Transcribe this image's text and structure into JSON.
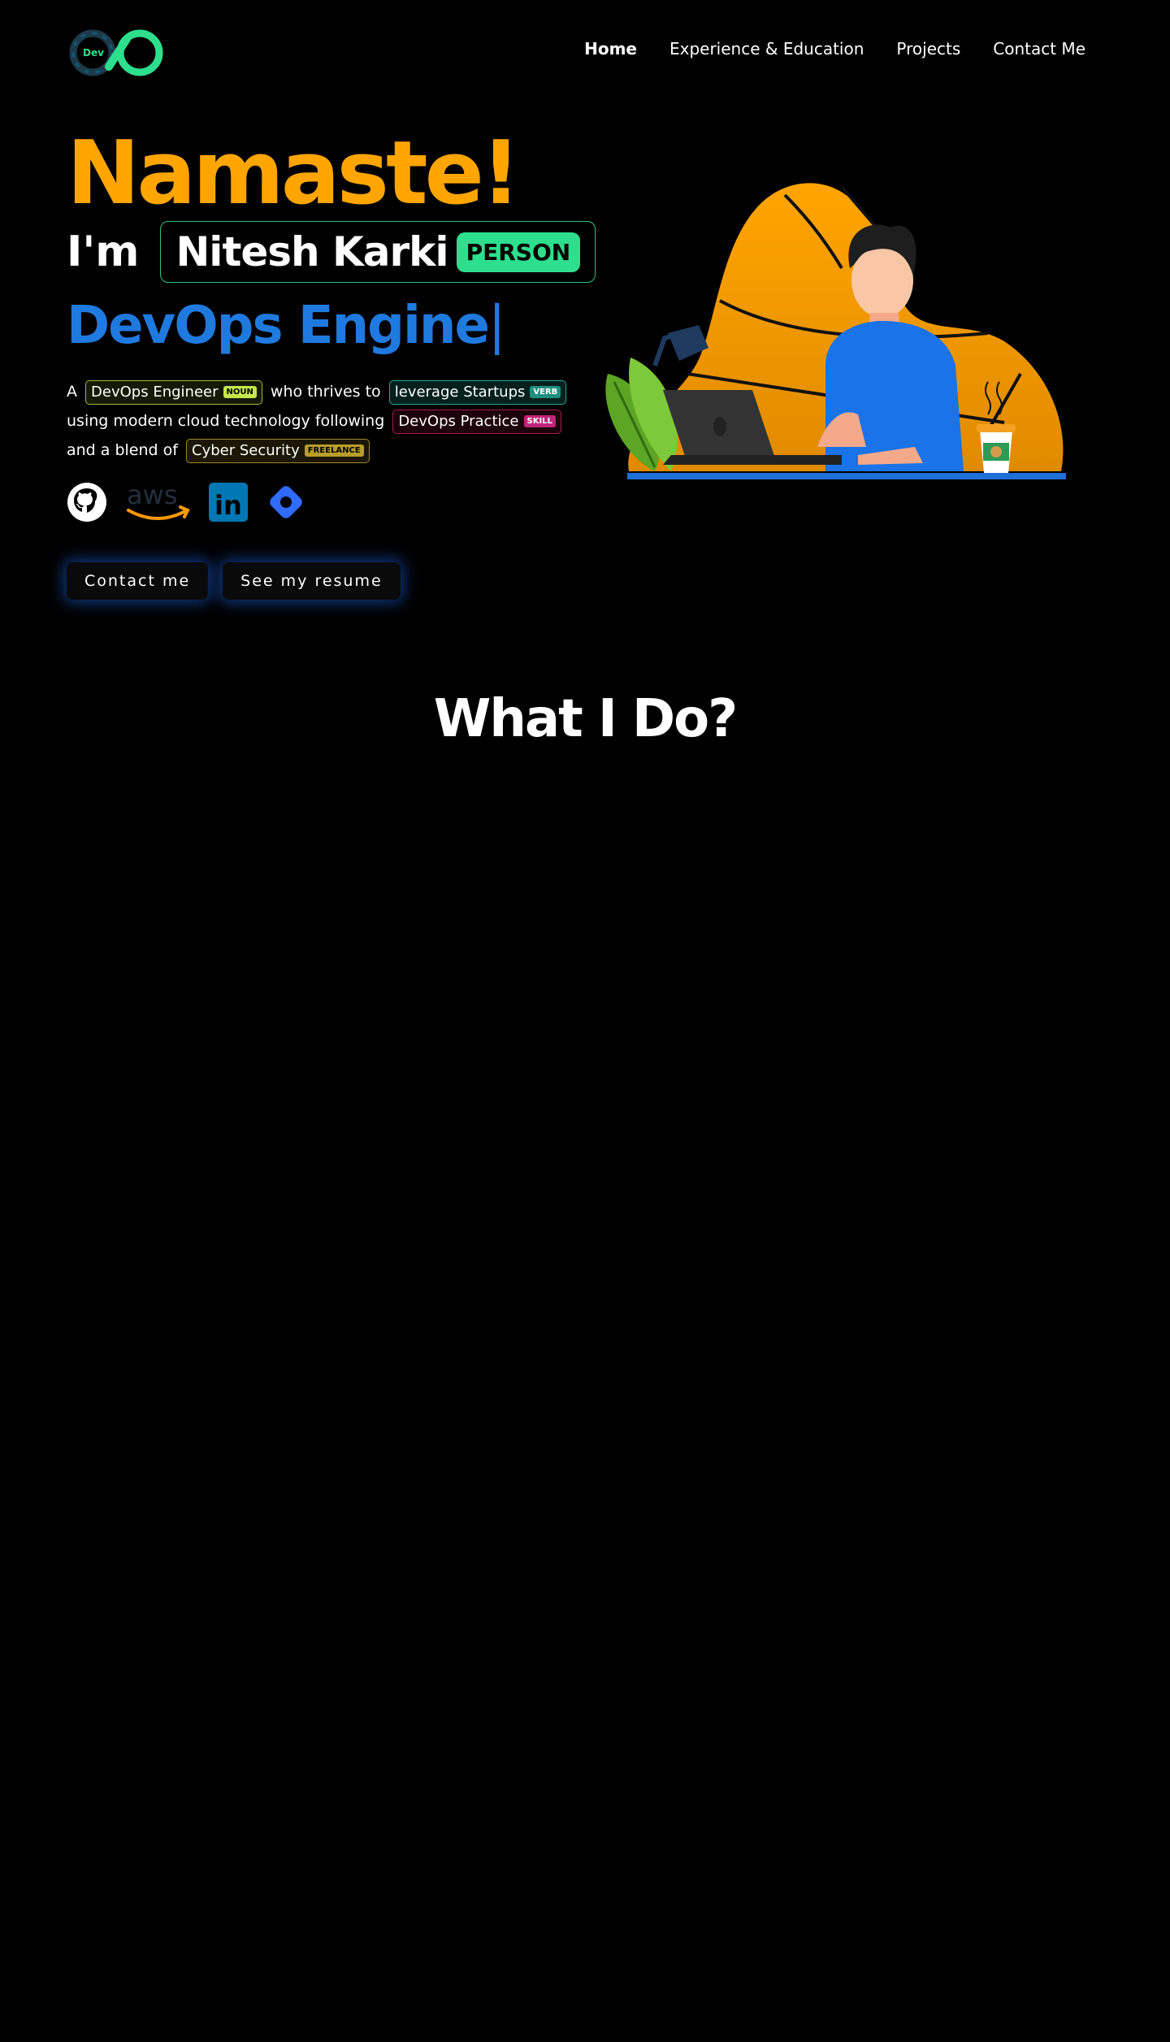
{
  "nav": {
    "logo_text": "Dev",
    "items": [
      {
        "label": "Home",
        "active": true
      },
      {
        "label": "Experience & Education",
        "active": false
      },
      {
        "label": "Projects",
        "active": false
      },
      {
        "label": "Contact Me",
        "active": false
      }
    ]
  },
  "hero": {
    "greeting": "Namaste!",
    "im": "I'm",
    "name": "Nitesh Karki",
    "name_tag": "PERSON",
    "role": "DevOps Engine",
    "role_cursor": "|",
    "description": {
      "t1": "A",
      "chip1": {
        "label": "DevOps Engineer",
        "tag": "NOUN"
      },
      "t2": "who thrives to",
      "chip2": {
        "label": "leverage Startups",
        "tag": "VERB"
      },
      "t3": "using modern cloud technology following",
      "chip3": {
        "label": "DevOps Practice",
        "tag": "SKILL"
      },
      "t4": "and a blend of",
      "chip4": {
        "label": "Cyber Security",
        "tag": "FREELANCE"
      }
    },
    "socials": [
      {
        "icon": "github-icon"
      },
      {
        "icon": "aws-icon",
        "text": "aws"
      },
      {
        "icon": "linkedin-icon",
        "text": "in"
      },
      {
        "icon": "diamond-icon"
      }
    ],
    "buttons": {
      "contact": "Contact me",
      "resume": "See my resume"
    }
  },
  "what_i_do": {
    "title": "What I Do?"
  },
  "colors": {
    "accent_orange": "#FFA500",
    "accent_blue": "#1f7ae0",
    "accent_green": "#2ddf8d",
    "background": "#000000"
  }
}
